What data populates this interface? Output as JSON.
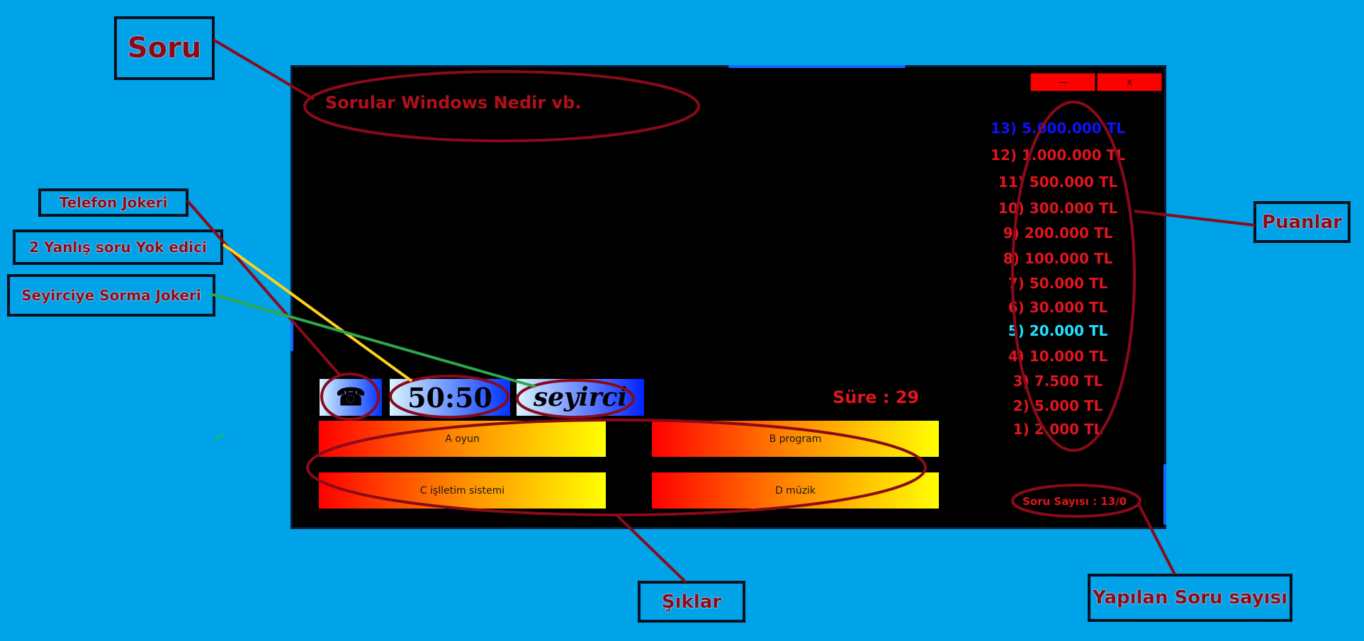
{
  "callouts": {
    "soru": "Soru",
    "telefon": "Telefon Jokeri",
    "yanlis": "2 Yanlış soru Yok edici",
    "seyirci": "Seyirciye Sorma Jokeri",
    "puanlar": "Puanlar",
    "siklar": "Şıklar",
    "yapilan": "Yapılan Soru sayısı"
  },
  "window": {
    "minimize_label": "—",
    "close_label": "x"
  },
  "question": {
    "text": "Sorular Windows Nedir vb."
  },
  "jokers": {
    "phone_icon": "☎",
    "fifty_label": "50:50",
    "audience_label": "seyirci"
  },
  "timer": {
    "text": "Süre : 29"
  },
  "answers": {
    "a": "A oyun",
    "b": "B program",
    "c": "C işlletim sistemi",
    "d": "D müzik"
  },
  "prize_ladder": [
    {
      "label": "13) 5.000.000 TL",
      "color": "#1010ff"
    },
    {
      "label": "12) 1.000.000 TL",
      "color": "#e0151e"
    },
    {
      "label": "11) 500.000 TL",
      "color": "#e0151e"
    },
    {
      "label": "10) 300.000 TL",
      "color": "#e0151e"
    },
    {
      "label": "9) 200.000 TL",
      "color": "#e0151e"
    },
    {
      "label": "8) 100.000 TL",
      "color": "#e0151e"
    },
    {
      "label": "7) 50.000 TL",
      "color": "#e0151e"
    },
    {
      "label": "6) 30.000 TL",
      "color": "#e0151e"
    },
    {
      "label": "5) 20.000 TL",
      "color": "#22e0ff"
    },
    {
      "label": "4) 10.000 TL",
      "color": "#e0151e"
    },
    {
      "label": "3) 7.500 TL",
      "color": "#e0151e"
    },
    {
      "label": "2) 5.000 TL",
      "color": "#e0151e"
    },
    {
      "label": "1)  2.000 TL",
      "color": "#e0151e"
    }
  ],
  "question_count": {
    "text": "Soru Sayısı : 13/0"
  },
  "colors": {
    "background": "#00a2e8",
    "annotation": "#8a0a1a",
    "accent_red": "#e0151e",
    "yellow_line": "#ffd21a",
    "green_line": "#2ea84a"
  }
}
